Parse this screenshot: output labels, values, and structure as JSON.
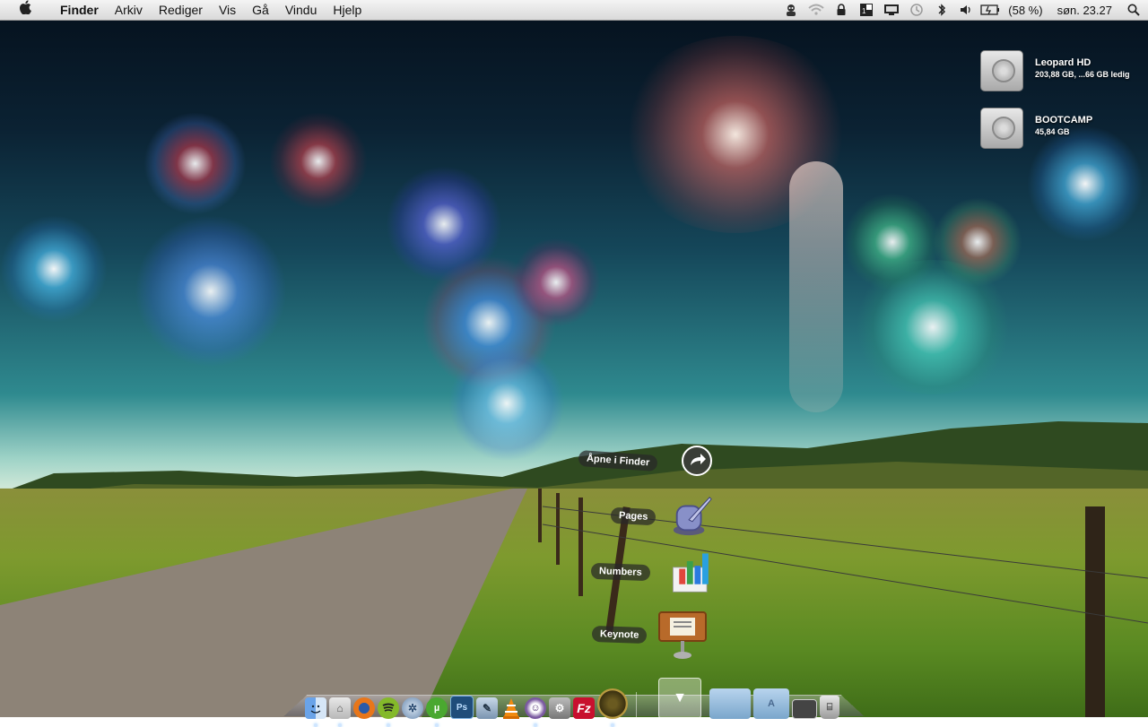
{
  "menubar": {
    "apple_icon": "apple-logo",
    "app_name": "Finder",
    "menus": [
      "Arkiv",
      "Rediger",
      "Vis",
      "Gå",
      "Vindu",
      "Hjelp"
    ],
    "battery": "(58 %)",
    "clock": "søn. 23.27",
    "status_icons": [
      "user-icon",
      "wifi-icon",
      "lock-icon",
      "spaces-icon",
      "display-icon",
      "time-machine-icon",
      "bluetooth-icon",
      "volume-icon",
      "battery-icon",
      "spotlight-icon"
    ]
  },
  "desktop_icons": [
    {
      "name": "Leopard HD",
      "info": "203,88 GB, ...66 GB ledig"
    },
    {
      "name": "BOOTCAMP",
      "info": "45,84 GB"
    }
  ],
  "stack": {
    "open_in_finder": "Åpne i Finder",
    "items": [
      {
        "label": "Pages"
      },
      {
        "label": "Numbers"
      },
      {
        "label": "Keynote"
      }
    ]
  },
  "dock": {
    "apps": [
      "Finder",
      "Preview",
      "Firefox",
      "Spotify",
      "Network",
      "uTorrent",
      "Photoshop",
      "Script",
      "VLC",
      "Adium",
      "Screenshot",
      "FileZilla",
      "Radar"
    ],
    "folders": [
      "Programmer",
      "Dokumenter",
      "Programmer-stack",
      "Skjermbilder",
      "Papirkurv"
    ]
  },
  "colors": {
    "menubar_bg": "#e6e6e6",
    "label_bg": "#2a2a2a",
    "firefox": "#e8761a",
    "spotify": "#84b92a",
    "photoshop": "#1f4d7a",
    "filezilla": "#c8102e"
  }
}
